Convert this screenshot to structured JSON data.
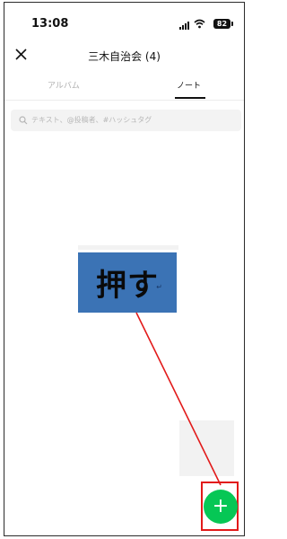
{
  "status_bar": {
    "time": "13:08",
    "battery": "82",
    "icons": [
      "signal-icon",
      "wifi-icon",
      "battery-icon"
    ]
  },
  "header": {
    "close_icon": "close-icon",
    "title": "三木自治会 (4)"
  },
  "tabs": [
    {
      "label": "アルバム",
      "active": false
    },
    {
      "label": "ノート",
      "active": true
    }
  ],
  "search": {
    "placeholder": "テキスト、@投稿者、#ハッシュタグ",
    "icon": "search-icon"
  },
  "annotation": {
    "text": "押す",
    "mark": "↵",
    "box_color": "#3b73b5",
    "arrow_color": "#e21a1a"
  },
  "fab": {
    "label": "+",
    "color": "#06c755",
    "icon": "plus-icon"
  }
}
